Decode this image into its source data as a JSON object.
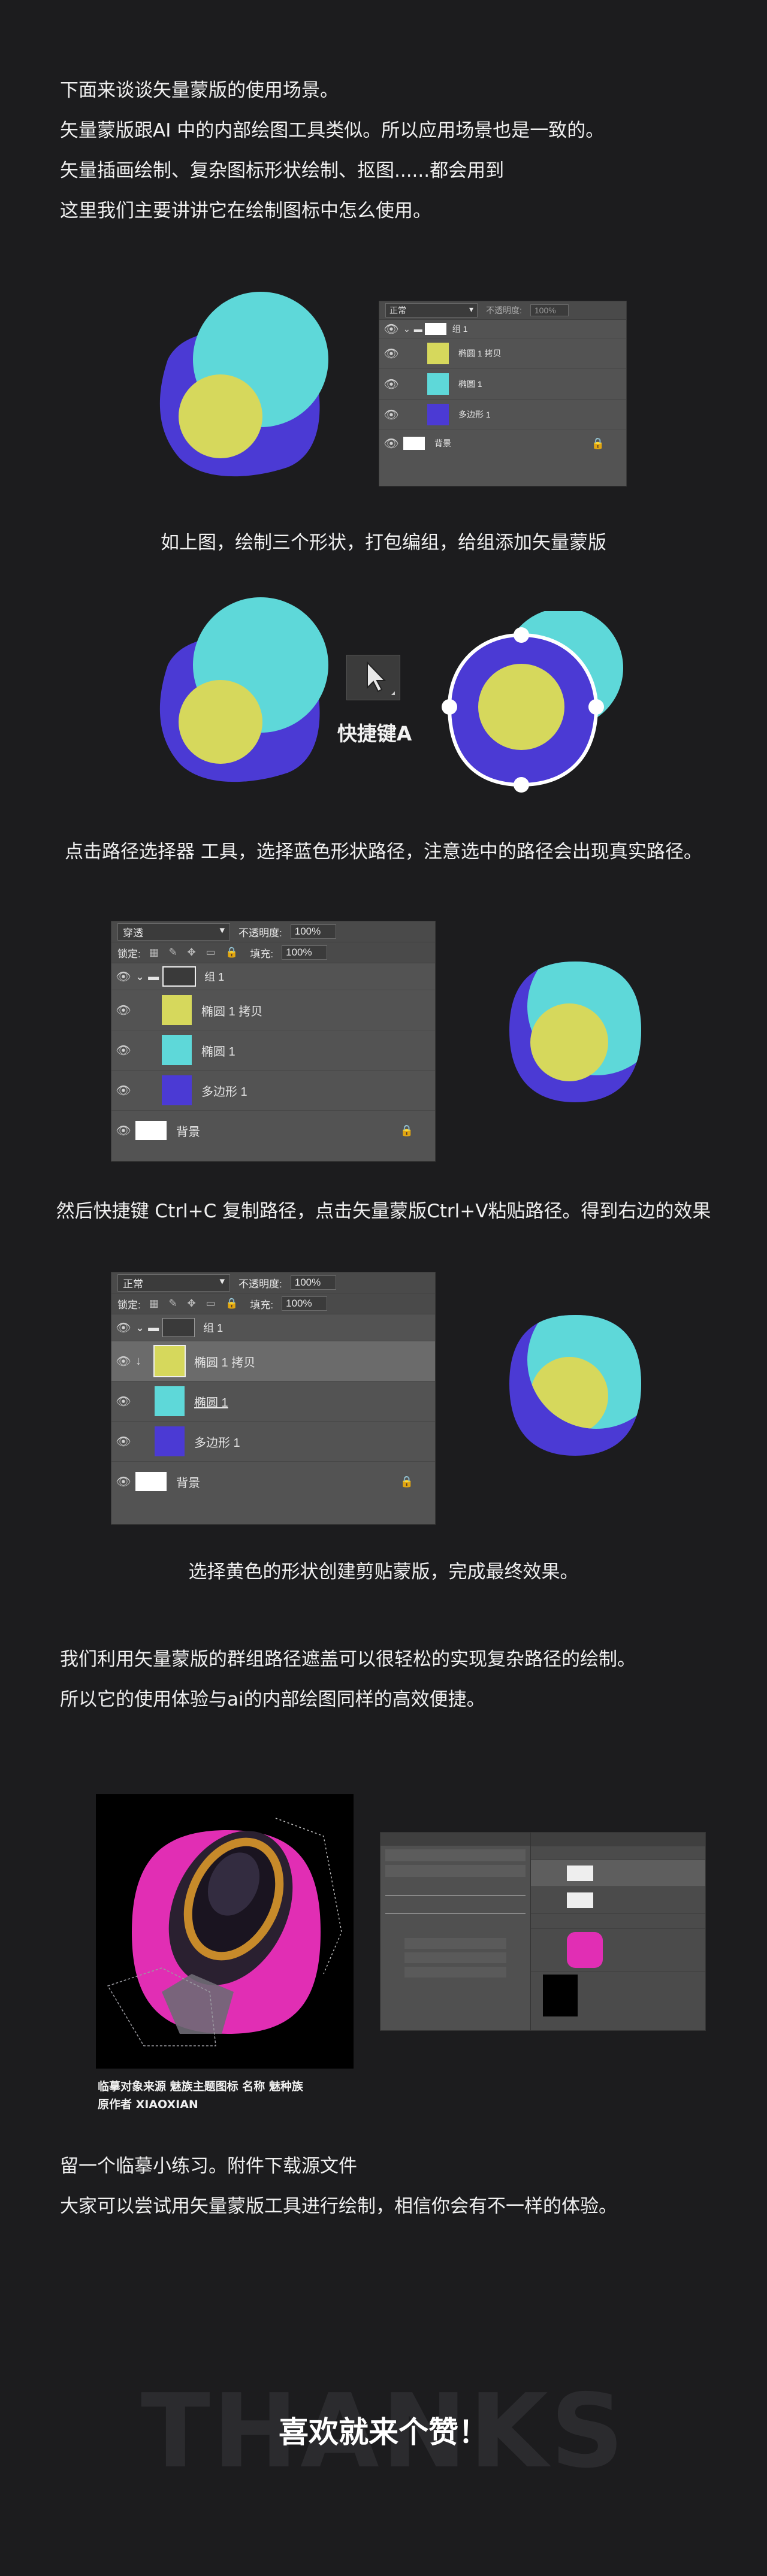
{
  "intro": {
    "lines": [
      "下面来谈谈矢量蒙版的使用场景。",
      "矢量蒙版跟AI 中的内部绘图工具类似。所以应用场景也是一致的。",
      "矢量插画绘制、复杂图标形状绘制、抠图......都会用到",
      "这里我们主要讲讲它在绘制图标中怎么使用。"
    ]
  },
  "step1": {
    "panel": {
      "blend": "正常",
      "opacity_label": "不透明度:",
      "opacity": "100%",
      "layers": [
        {
          "name": "组 1",
          "type": "group"
        },
        {
          "name": "椭圆 1 拷贝",
          "type": "layer",
          "color": "#d6d85c"
        },
        {
          "name": "椭圆 1",
          "type": "layer",
          "color": "#5ed8d9"
        },
        {
          "name": "多边形 1",
          "type": "layer",
          "color": "#4b3ad4"
        },
        {
          "name": "背景",
          "type": "background"
        }
      ]
    },
    "caption": "如上图，绘制三个形状，打包编组，给组添加矢量蒙版"
  },
  "step2": {
    "shortcut": "快捷键A",
    "caption": "点击路径选择器 工具，选择蓝色形状路径，注意选中的路径会出现真实路径。"
  },
  "step3": {
    "panel": {
      "blend": "穿透",
      "opacity_label": "不透明度:",
      "opacity": "100%",
      "lock_label": "锁定:",
      "fill_label": "填充:",
      "fill": "100%",
      "layers": [
        {
          "name": "组 1",
          "type": "group"
        },
        {
          "name": "椭圆 1 拷贝",
          "type": "layer",
          "color": "#d6d85c"
        },
        {
          "name": "椭圆 1",
          "type": "layer",
          "color": "#5ed8d9"
        },
        {
          "name": "多边形 1",
          "type": "layer",
          "color": "#4b3ad4"
        },
        {
          "name": "背景",
          "type": "background"
        }
      ]
    },
    "caption": "然后快捷键 Ctrl+C 复制路径，点击矢量蒙版Ctrl+V粘贴路径。得到右边的效果"
  },
  "step4": {
    "panel": {
      "blend": "正常",
      "opacity_label": "不透明度:",
      "opacity": "100%",
      "lock_label": "锁定:",
      "fill_label": "填充:",
      "fill": "100%",
      "layers": [
        {
          "name": "组 1",
          "type": "group"
        },
        {
          "name": "椭圆 1 拷贝",
          "type": "layer",
          "color": "#d6d85c"
        },
        {
          "name": "椭圆 1",
          "type": "layer",
          "color": "#5ed8d9"
        },
        {
          "name": "多边形 1",
          "type": "layer",
          "color": "#4b3ad4"
        },
        {
          "name": "背景",
          "type": "background"
        }
      ]
    },
    "caption": "选择黄色的形状创建剪贴蒙版，完成最终效果。"
  },
  "summary": {
    "lines": [
      "我们利用矢量蒙版的群组路径遮盖可以很轻松的实现复杂路径的绘制。",
      "所以它的使用体验与ai的内部绘图同样的高效便捷。"
    ]
  },
  "reference": {
    "credit_line1": "临摹对象来源  魅族主题图标  名称 魅种族",
    "credit_line2": "原作者  XIAOXIAN"
  },
  "exercise": {
    "lines": [
      "留一个临摹小练习。附件下载源文件",
      "大家可以尝试用矢量蒙版工具进行绘制，相信你会有不一样的体验。"
    ]
  },
  "footer": {
    "bg_text": "THANKS",
    "title": "喜欢就来个赞！"
  },
  "colors": {
    "background": "#1c1c1e",
    "cyan": "#5ed8d9",
    "purple": "#4b3ad4",
    "yellow": "#d6d85c",
    "magenta": "#e12eb4"
  }
}
